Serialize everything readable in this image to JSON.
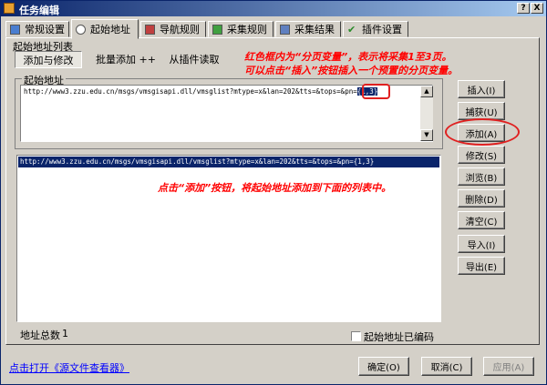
{
  "window": {
    "title": "任务编辑"
  },
  "tabs": [
    {
      "label": "常规设置",
      "icon": "general-icon"
    },
    {
      "label": "起始地址",
      "icon": "search-icon"
    },
    {
      "label": "导航规则",
      "icon": "navigation-icon"
    },
    {
      "label": "采集规则",
      "icon": "collect-icon"
    },
    {
      "label": "采集结果",
      "icon": "result-icon"
    },
    {
      "label": "插件设置",
      "icon": "plugin-icon"
    }
  ],
  "group": {
    "label": "起始地址列表"
  },
  "subtabs": [
    "添加与修改",
    "批量添加 ++",
    "从插件读取"
  ],
  "notes": {
    "line1": "红色框内为“分页变量”，表示将采集1至3页。",
    "line2": "可以点击“插入”按钮插入一个预置的分页变量。",
    "line3": "点击“添加”按钮，将起始地址添加到下面的列表中。"
  },
  "start_url": {
    "label": "起始地址",
    "prefix": "http://www3.zzu.edu.cn/msgs/vmsgisapi.dll/vmsglist?mtype=x&lan=202&tts=&tops=&pn=",
    "variable": "{1,3}"
  },
  "list": {
    "items": [
      "http://www3.zzu.edu.cn/msgs/vmsgisapi.dll/vmsglist?mtype=x&lan=202&tts=&tops=&pn={1,3}"
    ]
  },
  "side_buttons": [
    "插入(I)",
    "捕获(U)",
    "添加(A)",
    "修改(S)",
    "浏览(B)",
    "删除(D)",
    "清空(C)",
    "导入(I)",
    "导出(E)"
  ],
  "count": {
    "label": "地址总数",
    "value": "1"
  },
  "encode": {
    "label": "起始地址已编码",
    "checked": false
  },
  "footer": {
    "link": "点击打开《源文件查看器》",
    "ok": "确定(O)",
    "cancel": "取消(C)",
    "apply": "应用(A)"
  },
  "title_buttons": {
    "help": "?",
    "close": "X"
  }
}
